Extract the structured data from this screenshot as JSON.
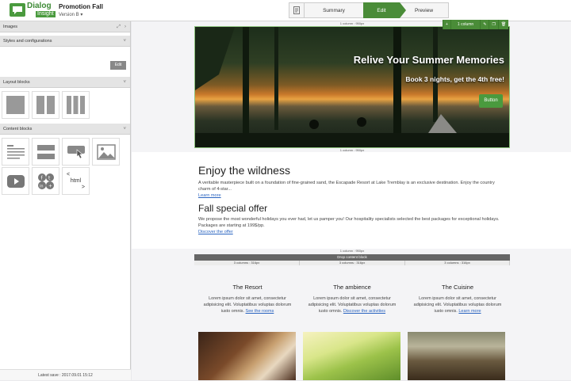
{
  "app": {
    "logo_main": "Dialog",
    "logo_sub": "Insight",
    "project_title": "Promotion Fall",
    "version": "Version B"
  },
  "steps": [
    {
      "label": "Summary"
    },
    {
      "label": "Edit"
    },
    {
      "label": "Preview"
    }
  ],
  "sidebar": {
    "sections": [
      {
        "label": "Images"
      },
      {
        "label": "Styles and configurations"
      },
      {
        "label": "Layout blocks"
      },
      {
        "label": "Content blocks"
      }
    ],
    "edit_label": "Edit",
    "html_block_label": "html",
    "latest_save": "Latest save : 2017.09.01 15:12"
  },
  "canvas": {
    "ruler_top": "1 column : 950px",
    "ruler_bottom": "1 column : 950px",
    "toolbar_col": "1 column",
    "hero": {
      "title": "Relive Your Summer Memories",
      "subtitle": "Book 3 nights, get the 4th free!",
      "button": "Button"
    },
    "article1": {
      "title": "Enjoy the wildness",
      "body": "A veritable masterpiece built on a foundation of fine-grained sand, the Escapade Resort at Lake Tremblay is an exclusive destination. Enjoy the country charm of 4-star...",
      "link": "Learn more"
    },
    "article2": {
      "title": "Fall special offer",
      "body": "We propose the most wonderful holidays you ever had, let us pamper you! Our hospitality specialists selected the best packages for exceptional holidays. Packages are starting at 199$/pp.",
      "link": "Discover the offer"
    },
    "ruler_mid": "1 column : 950px",
    "drop_label": "Drop content block",
    "col_rulers": [
      "3 columns : 316px",
      "3 columns : 316px",
      "3 columns : 316px"
    ],
    "columns": [
      {
        "title": "The Resort",
        "body": "Lorem ipsum dolor sit amet, consectetur adipisicing elit. Voluptatibus voluptas dolorum iusto omnis.",
        "link": "See the rooms"
      },
      {
        "title": "The ambience",
        "body": "Lorem ipsum dolor sit amet, consectetur adipisicing elit. Voluptatibus voluptas dolorum iusto omnis.",
        "link": "Discover the activities"
      },
      {
        "title": "The Cuisine",
        "body": "Lorem ipsum dolor sit amet, consectetur adipisicing elit. Voluptatibus voluptas dolorum iusto omnis.",
        "link": "Learn more"
      }
    ]
  }
}
